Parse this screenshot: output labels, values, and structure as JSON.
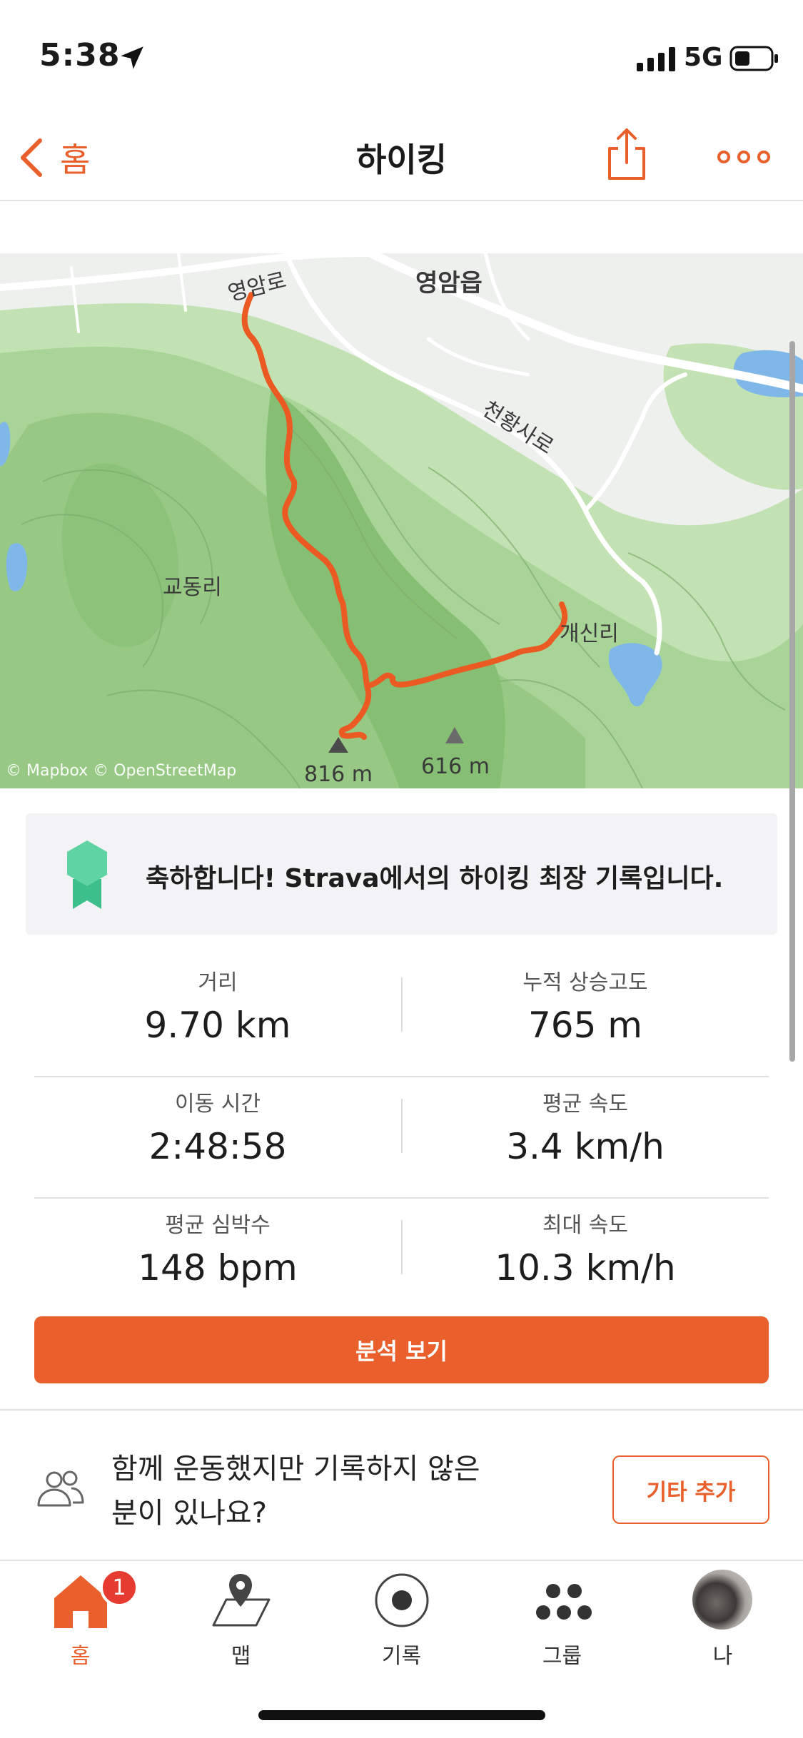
{
  "status_bar": {
    "time": "5:38",
    "network": "5G"
  },
  "nav": {
    "back_label": "홈",
    "title": "하이킹"
  },
  "map": {
    "labels": {
      "road_yeongam": "영암로",
      "town_yeongam": "영암읍",
      "road_cheonhwangsa": "천황사로",
      "village_gyodong": "교동리",
      "village_gaesin": "개신리",
      "peak1": "816 m",
      "peak2": "616 m"
    },
    "attribution": "© Mapbox © OpenStreetMap",
    "colors": {
      "route": "#ea5a22",
      "terrain": "#b9dba9",
      "water": "#7fb8e8"
    }
  },
  "achievement": {
    "text": "축하합니다! Strava에서의 하이킹 최장 기록입니다."
  },
  "stats": [
    {
      "left": {
        "label": "거리",
        "value": "9.70 km"
      },
      "right": {
        "label": "누적 상승고도",
        "value": "765 m"
      }
    },
    {
      "left": {
        "label": "이동 시간",
        "value": "2:48:58"
      },
      "right": {
        "label": "평균 속도",
        "value": "3.4 km/h"
      }
    },
    {
      "left": {
        "label": "평균 심박수",
        "value": "148 bpm"
      },
      "right": {
        "label": "최대 속도",
        "value": "10.3 km/h"
      }
    }
  ],
  "analysis_button": "분석 보기",
  "together": {
    "line1": "함께 운동했지만 기록하지 않은",
    "line2": "분이 있나요?",
    "button": "기타 추가"
  },
  "tabs": [
    {
      "label": "홈",
      "icon": "home-icon",
      "badge": "1",
      "active": true
    },
    {
      "label": "맵",
      "icon": "map-icon"
    },
    {
      "label": "기록",
      "icon": "record-icon"
    },
    {
      "label": "그룹",
      "icon": "groups-icon"
    },
    {
      "label": "나",
      "icon": "avatar"
    }
  ],
  "accent_color": "#e9602d"
}
